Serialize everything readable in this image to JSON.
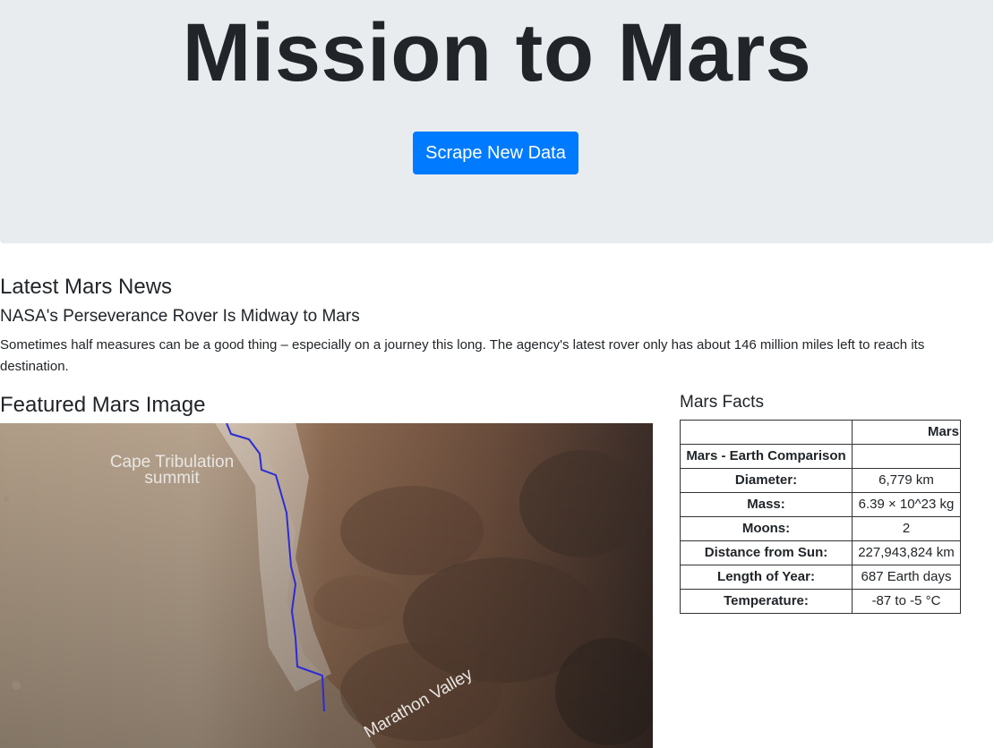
{
  "header": {
    "title": "Mission to Mars",
    "scrape_button": "Scrape New Data"
  },
  "news": {
    "heading": "Latest Mars News",
    "title": "NASA's Perseverance Rover Is Midway to Mars",
    "paragraph": "Sometimes half measures can be a good thing – especially on a journey this long. The agency's latest rover only has about 146 million miles left to reach its destination."
  },
  "featured_image": {
    "heading": "Featured Mars Image",
    "label_summit_line1": "Cape Tribulation",
    "label_summit_line2": "summit",
    "label_valley": "Marathon Valley"
  },
  "facts": {
    "heading": "Mars Facts",
    "column_header": "Mars",
    "rows": [
      {
        "label": "Mars - Earth Comparison",
        "value": ""
      },
      {
        "label": "Diameter:",
        "value": "6,779 km"
      },
      {
        "label": "Mass:",
        "value": "6.39 × 10^23 kg"
      },
      {
        "label": "Moons:",
        "value": "2"
      },
      {
        "label": "Distance from Sun:",
        "value": "227,943,824 km"
      },
      {
        "label": "Length of Year:",
        "value": "687 Earth days"
      },
      {
        "label": "Temperature:",
        "value": "-87 to -5 °C"
      }
    ]
  },
  "colors": {
    "jumbotron_bg": "#e9ecef",
    "button_bg": "#007bff",
    "text": "#212529",
    "route_line": "#2b2bd6"
  }
}
